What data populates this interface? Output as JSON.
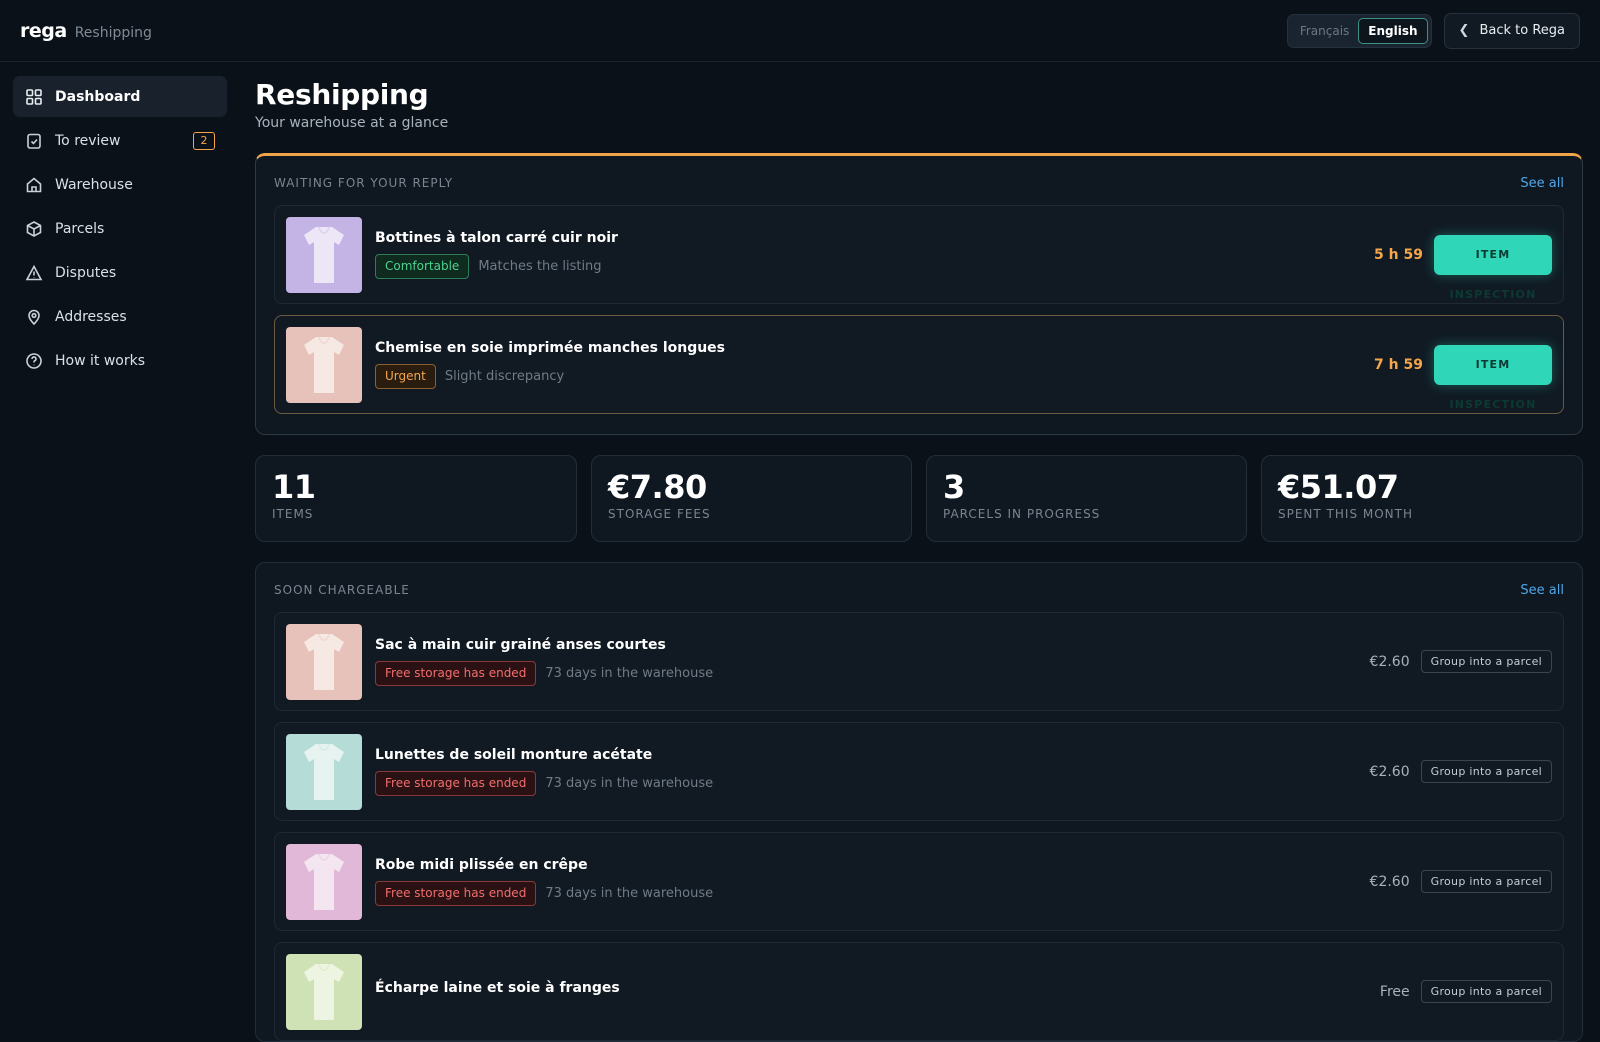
{
  "brand": {
    "logo": "rega",
    "section": "Reshipping"
  },
  "languages": [
    {
      "label": "Français",
      "active": false
    },
    {
      "label": "English",
      "active": true
    }
  ],
  "back_button": "Back to Rega",
  "sidebar": {
    "items": [
      {
        "label": "Dashboard",
        "icon": "grid-icon",
        "active": true
      },
      {
        "label": "To review",
        "icon": "clipboard-check-icon",
        "badge": "2"
      },
      {
        "label": "Warehouse",
        "icon": "home-icon"
      },
      {
        "label": "Parcels",
        "icon": "box-icon"
      },
      {
        "label": "Disputes",
        "icon": "warning-icon"
      },
      {
        "label": "Addresses",
        "icon": "map-pin-icon"
      },
      {
        "label": "How it works",
        "icon": "help-circle-icon"
      }
    ]
  },
  "page": {
    "title": "Reshipping",
    "subtitle": "Your warehouse at a glance"
  },
  "waiting": {
    "title": "WAITING FOR YOUR REPLY",
    "see_all": "See all",
    "items": [
      {
        "name": "Bottines à talon carré cuir noir",
        "tag": "Comfortable",
        "tag_color": "#4bd38e",
        "note": "Matches the listing",
        "timer": "5 h 59",
        "action": "ITEM INSPECTION",
        "thumb_color": "#c4b4e6"
      },
      {
        "name": "Chemise en soie imprimée manches longues",
        "tag": "Urgent",
        "tag_color": "#f5a54a",
        "note": "Slight discrepancy",
        "timer": "7 h 59",
        "action": "ITEM INSPECTION",
        "thumb_color": "#e6c2ba"
      }
    ]
  },
  "stats": [
    {
      "value": "11",
      "label": "ITEMS"
    },
    {
      "value": "€7.80",
      "label": "STORAGE FEES"
    },
    {
      "value": "3",
      "label": "PARCELS IN PROGRESS"
    },
    {
      "value": "€51.07",
      "label": "SPENT THIS MONTH"
    }
  ],
  "soon": {
    "title": "SOON CHARGEABLE",
    "see_all": "See all",
    "items": [
      {
        "name": "Sac à main cuir grainé anses courtes",
        "tag": "Free storage has ended",
        "note": "73 days in the warehouse",
        "price": "€2.60",
        "action": "Group into a parcel",
        "thumb_color": "#e6c2ba"
      },
      {
        "name": "Lunettes de soleil monture acétate",
        "tag": "Free storage has ended",
        "note": "73 days in the warehouse",
        "price": "€2.60",
        "action": "Group into a parcel",
        "thumb_color": "#b6dcd8"
      },
      {
        "name": "Robe midi plissée en crêpe",
        "tag": "Free storage has ended",
        "note": "73 days in the warehouse",
        "price": "€2.60",
        "action": "Group into a parcel",
        "thumb_color": "#e2b8d8"
      },
      {
        "name": "Écharpe laine et soie à franges",
        "tag": "",
        "note": "",
        "price": "Free",
        "action": "Group into a parcel",
        "thumb_color": "#cfe2b6"
      }
    ]
  },
  "colors": {
    "accent": "#2fd6b8",
    "warning": "#f0a54a",
    "link": "#4ea7e8",
    "background": "#0b1118"
  }
}
